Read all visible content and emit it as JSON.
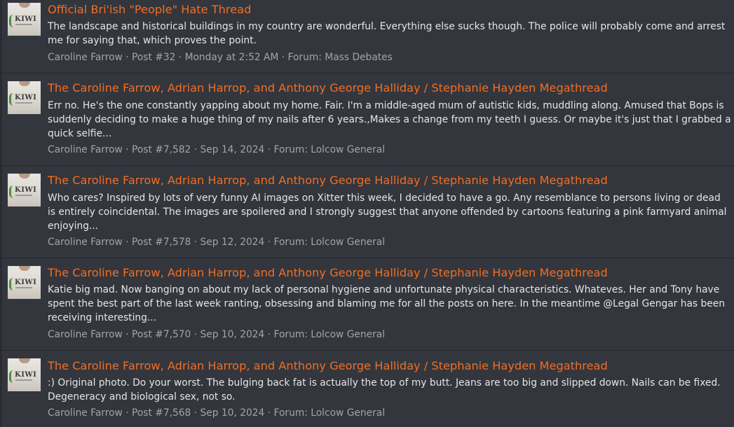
{
  "results": [
    {
      "title": "Official Bri'ish \"People\" Hate Thread",
      "snippet": "The landscape and historical buildings in my country are wonderful. Everything else sucks though. The police will probably come and arrest me for saying that, which proves the point.",
      "author": "Caroline Farrow",
      "post": "Post #32",
      "date": "Monday at 2:52 AM",
      "forum": "Forum: Mass Debates"
    },
    {
      "title": "The Caroline Farrow, Adrian Harrop, and Anthony George Halliday / Stephanie Hayden Megathread",
      "snippet": "Err no. He's the one constantly yapping about my home. Fair. I'm a middle-aged mum of autistic kids, muddling along. Amused that Bops is suddenly deciding to make a huge thing of my nails after 6 years.,Makes a change from my teeth I guess. Or maybe it's just that I grabbed a quick selfie...",
      "author": "Caroline Farrow",
      "post": "Post #7,582",
      "date": "Sep 14, 2024",
      "forum": "Forum: Lolcow General"
    },
    {
      "title": "The Caroline Farrow, Adrian Harrop, and Anthony George Halliday / Stephanie Hayden Megathread",
      "snippet": "Who cares? Inspired by lots of very funny AI images on Xitter this week, I decided to have a go. Any resemblance to persons living or dead is entirely coincidental. The images are spoilered and I strongly suggest that anyone offended by cartoons featuring a pink farmyard animal enjoying...",
      "author": "Caroline Farrow",
      "post": "Post #7,578",
      "date": "Sep 12, 2024",
      "forum": "Forum: Lolcow General"
    },
    {
      "title": "The Caroline Farrow, Adrian Harrop, and Anthony George Halliday / Stephanie Hayden Megathread",
      "snippet": "Katie big mad. Now banging on about my lack of personal hygiene and unfortunate physical characteristics. Whateves. Her and Tony have spent the best part of the last week ranting, obsessing and blaming me for all the posts on here. In the meantime @Legal Gengar has been receiving interesting...",
      "author": "Caroline Farrow",
      "post": "Post #7,570",
      "date": "Sep 10, 2024",
      "forum": "Forum: Lolcow General"
    },
    {
      "title": "The Caroline Farrow, Adrian Harrop, and Anthony George Halliday / Stephanie Hayden Megathread",
      "snippet": ":) Original photo. Do your worst. The bulging back fat is actually the top of my butt. Jeans are too big and slipped down. Nails can be fixed. Degeneracy and biological sex, not so.",
      "author": "Caroline Farrow",
      "post": "Post #7,568",
      "date": "Sep 10, 2024",
      "forum": "Forum: Lolcow General"
    }
  ],
  "avatar_logo_text": "KIWI",
  "meta_separator": " · ",
  "colors": {
    "title": "#f36d21",
    "text": "#e6e6e6",
    "meta": "#a2a4a8",
    "background": "#33363d"
  }
}
